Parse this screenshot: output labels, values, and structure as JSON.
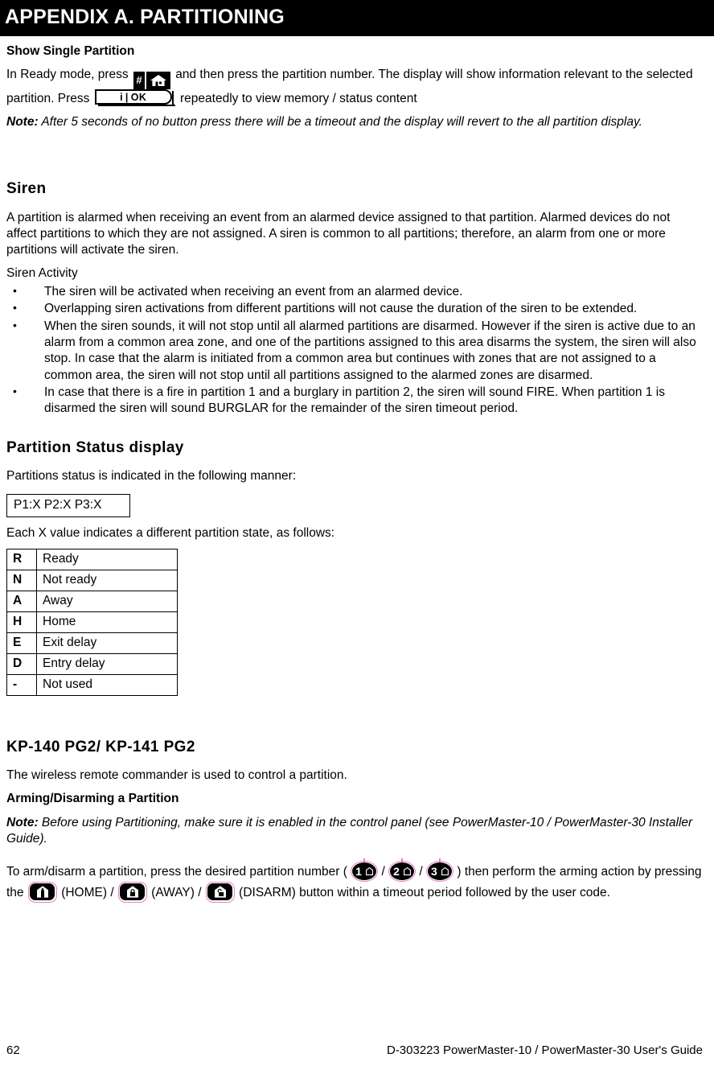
{
  "appendix": {
    "title": "APPENDIX A. PARTITIONING"
  },
  "show_single_partition": {
    "heading": "Show Single Partition",
    "para_part1": "In Ready mode, press",
    "para_part2": "and then press the partition number. The display will show information relevant to the selected partition. Press",
    "para_part3": "repeatedly to view memory / status content",
    "note_label": "Note:",
    "note_text": " After 5 seconds of no button press there will be a timeout and the display will revert to the all partition display."
  },
  "icons": {
    "hash_key": "#",
    "home_key": "home-icon",
    "ok_key_info": "i",
    "ok_key_label": "OK",
    "partition_keys": [
      "1",
      "2",
      "3"
    ],
    "home_button": "home-person-icon",
    "away_button": "house-locked-icon",
    "disarm_button": "house-unlocked-icon"
  },
  "siren": {
    "heading": "Siren",
    "intro": "A partition is alarmed when receiving an event from an alarmed device assigned to that partition. Alarmed devices do not affect partitions to which they are not assigned. A siren is common to all partitions; therefore, an alarm from one or more partitions will activate the siren.",
    "activity_label": "Siren Activity",
    "bullets": [
      "The siren will be activated when receiving an event from an alarmed device.",
      "Overlapping siren activations from different partitions will not cause the duration of the siren to be extended.",
      "When the siren sounds, it will not stop until all alarmed partitions are disarmed. However if the siren is active due to an alarm from a common area zone, and one of the partitions assigned to this area disarms the system, the siren will also stop. In case that the alarm is initiated from a common area but continues with zones that are not assigned to a common area, the siren will not stop until all partitions assigned to the alarmed zones are disarmed.",
      "In case that there is a fire in partition 1 and a burglary in partition 2, the siren will sound FIRE. When partition 1 is disarmed the siren will sound BURGLAR for the remainder of the siren timeout period."
    ]
  },
  "partition_status": {
    "heading": "Partition Status display",
    "intro": "Partitions status is indicated in the following manner:",
    "sample_display": "P1:X P2:X P3:X",
    "legend_intro": "Each X value indicates a different partition state, as follows:",
    "legend_rows": [
      {
        "code": "R",
        "meaning": "Ready"
      },
      {
        "code": "N",
        "meaning": "Not ready"
      },
      {
        "code": "A",
        "meaning": "Away"
      },
      {
        "code": "H",
        "meaning": "Home"
      },
      {
        "code": "E",
        "meaning": "Exit delay"
      },
      {
        "code": "D",
        "meaning": "Entry delay"
      },
      {
        "code": "-",
        "meaning": "Not used"
      }
    ]
  },
  "kp140": {
    "heading": "KP-140 PG2/ KP-141 PG2",
    "intro": "The wireless remote commander is used to control a partition.",
    "subheading": "Arming/Disarming a Partition",
    "note_label": "Note:",
    "note_text": " Before using Partitioning, make sure it is enabled in the control panel (see PowerMaster-10 / PowerMaster-30 Installer Guide).",
    "arm_part1": "To arm/disarm a partition, press the desired partition number (",
    "arm_sep": "/",
    "arm_part2": ") then perform the arming action by pressing the",
    "home_label": "(HOME) /",
    "away_label": "(AWAY) /",
    "disarm_label": "(DISARM) button within a timeout period followed by the user code."
  },
  "footer": {
    "page_number": "62",
    "document_reference": "D-303223 PowerMaster-10 / PowerMaster-30 User's Guide"
  },
  "colors": {
    "title_bar_bg": "#000000",
    "title_bar_fg": "#ffffff",
    "icon_outline_pink": "#e87ec0",
    "icon_body_black": "#000000",
    "text": "#000000"
  }
}
